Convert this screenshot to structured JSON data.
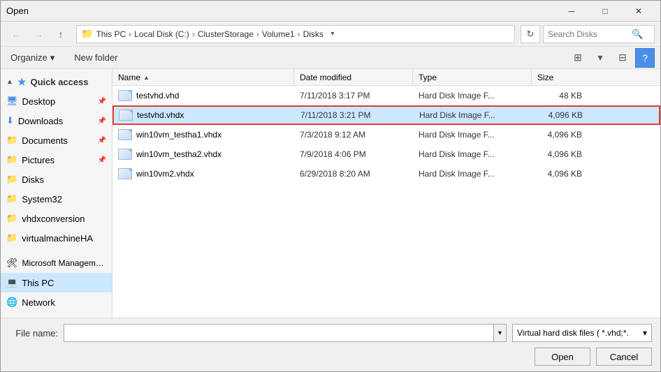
{
  "dialog": {
    "title": "Open"
  },
  "titlebar": {
    "title": "Open",
    "close_btn": "✕",
    "min_btn": "─",
    "max_btn": "□"
  },
  "toolbar": {
    "back_btn": "←",
    "forward_btn": "→",
    "up_btn": "↑",
    "address": {
      "icon": "📁",
      "path": [
        "This PC",
        "Local Disk (C:)",
        "ClusterStorage",
        "Volume1",
        "Disks"
      ]
    },
    "refresh_btn": "↻",
    "search_placeholder": "Search Disks",
    "search_icon": "🔍"
  },
  "ribbon": {
    "organize_label": "Organize",
    "organize_arrow": "▾",
    "new_folder_label": "New folder",
    "view_btn_1": "⊞",
    "view_btn_2": "⊟",
    "help_btn": "?"
  },
  "sidebar": {
    "quick_access_label": "Quick access",
    "items": [
      {
        "id": "desktop",
        "label": "Desktop",
        "icon": "desktop",
        "pinned": true
      },
      {
        "id": "downloads",
        "label": "Downloads",
        "icon": "download",
        "pinned": true
      },
      {
        "id": "documents",
        "label": "Documents",
        "icon": "folder",
        "pinned": true
      },
      {
        "id": "pictures",
        "label": "Pictures",
        "icon": "folder",
        "pinned": true
      },
      {
        "id": "disks",
        "label": "Disks",
        "icon": "folder_yellow"
      },
      {
        "id": "system32",
        "label": "System32",
        "icon": "folder_yellow"
      },
      {
        "id": "vhdxconversion",
        "label": "vhdxconversion",
        "icon": "folder_yellow"
      },
      {
        "id": "virtualmachineha",
        "label": "virtualmachineHA",
        "icon": "folder_yellow"
      }
    ],
    "other_items": [
      {
        "id": "mmc",
        "label": "Microsoft Manageme...",
        "icon": "mmc"
      },
      {
        "id": "thispc",
        "label": "This PC",
        "icon": "pc",
        "selected": true
      },
      {
        "id": "network",
        "label": "Network",
        "icon": "network"
      }
    ]
  },
  "filelist": {
    "columns": {
      "name": "Name",
      "date": "Date modified",
      "type": "Type",
      "size": "Size"
    },
    "files": [
      {
        "name": "testvhd.vhd",
        "date": "7/11/2018 3:17 PM",
        "type": "Hard Disk Image F...",
        "size": "48 KB",
        "selected": false,
        "highlighted": false
      },
      {
        "name": "testvhd.vhdx",
        "date": "7/11/2018 3:21 PM",
        "type": "Hard Disk Image F...",
        "size": "4,096 KB",
        "selected": true,
        "highlighted": true
      },
      {
        "name": "win10vm_testha1.vhdx",
        "date": "7/3/2018 9:12 AM",
        "type": "Hard Disk Image F...",
        "size": "4,096 KB",
        "selected": false,
        "highlighted": false
      },
      {
        "name": "win10vm_testha2.vhdx",
        "date": "7/9/2018 4:06 PM",
        "type": "Hard Disk Image F...",
        "size": "4,096 KB",
        "selected": false,
        "highlighted": false
      },
      {
        "name": "win10vm2.vhdx",
        "date": "6/29/2018 8:20 AM",
        "type": "Hard Disk Image F...",
        "size": "4,096 KB",
        "selected": false,
        "highlighted": false
      }
    ]
  },
  "bottom": {
    "filename_label": "File name:",
    "filename_value": "",
    "filetype_label": "Virtual hard disk files  ( *.vhd;*.",
    "open_btn": "Open",
    "cancel_btn": "Cancel"
  }
}
